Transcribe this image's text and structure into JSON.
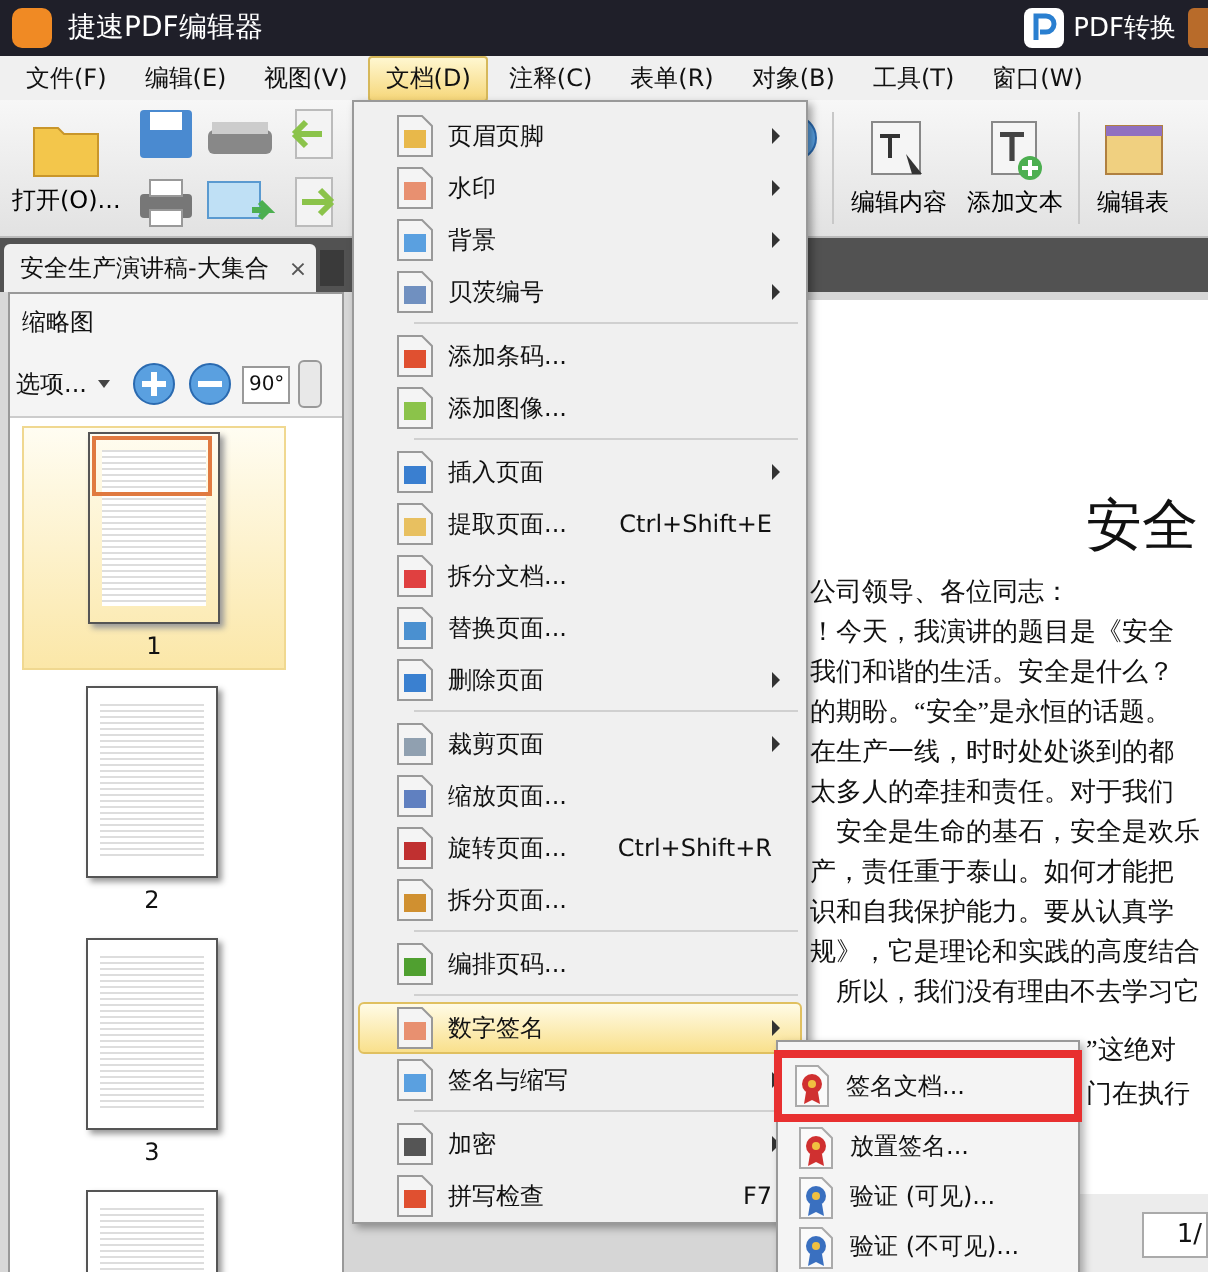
{
  "window": {
    "title": "捷速PDF编辑器",
    "convert_button": "PDF转换"
  },
  "menu_bar": [
    {
      "label": "文件(F)",
      "selected": false
    },
    {
      "label": "编辑(E)",
      "selected": false
    },
    {
      "label": "视图(V)",
      "selected": false
    },
    {
      "label": "文档(D)",
      "selected": true
    },
    {
      "label": "注释(C)",
      "selected": false
    },
    {
      "label": "表单(R)",
      "selected": false
    },
    {
      "label": "对象(B)",
      "selected": false
    },
    {
      "label": "工具(T)",
      "selected": false
    },
    {
      "label": "窗口(W)",
      "selected": false
    }
  ],
  "toolbar": {
    "open": "打开(O)...",
    "edit_content": "编辑内容",
    "add_text": "添加文本",
    "edit_form": "编辑表"
  },
  "document_tab": {
    "title": "安全生产演讲稿-大集合",
    "close": "×"
  },
  "thumbnail_panel": {
    "title": "缩略图",
    "options": "选项...",
    "rotate": "90°",
    "pages": [
      {
        "label": "1",
        "selected": true
      },
      {
        "label": "2",
        "selected": false
      },
      {
        "label": "3",
        "selected": false
      },
      {
        "selected": false
      }
    ]
  },
  "document": {
    "heading": "安全",
    "lines": [
      "公司领导、各位同志：",
      "！今天，我演讲的题目是《安全",
      "我们和谐的生活。安全是什么？",
      "的期盼。“安全”是永恒的话题。",
      "在生产一线，时时处处谈到的都",
      "太多人的牵挂和责任。对于我们",
      "　安全是生命的基石，安全是欢乐",
      "产，责任重于泰山。如何才能把",
      "识和自我保护能力。要从认真学",
      "规》，它是理论和实践的高度结合",
      "　所以，我们没有理由不去学习它"
    ],
    "covered_lines": [
      "”这绝对",
      "门在执行"
    ],
    "page_field": "1/"
  },
  "document_menu": [
    {
      "kind": "item",
      "label": "页眉页脚",
      "submenu": true,
      "selected": false
    },
    {
      "kind": "item",
      "label": "水印",
      "submenu": true,
      "selected": false
    },
    {
      "kind": "item",
      "label": "背景",
      "submenu": true,
      "selected": false
    },
    {
      "kind": "item",
      "label": "贝茨编号",
      "submenu": true,
      "selected": false
    },
    {
      "kind": "separator"
    },
    {
      "kind": "item",
      "label": "添加条码...",
      "submenu": false,
      "selected": false
    },
    {
      "kind": "item",
      "label": "添加图像...",
      "submenu": false,
      "selected": false
    },
    {
      "kind": "separator"
    },
    {
      "kind": "item",
      "label": "插入页面",
      "submenu": true,
      "selected": false
    },
    {
      "kind": "item",
      "label": "提取页面...",
      "shortcut": "Ctrl+Shift+E",
      "submenu": false,
      "selected": false
    },
    {
      "kind": "item",
      "label": "拆分文档...",
      "submenu": false,
      "selected": false
    },
    {
      "kind": "item",
      "label": "替换页面...",
      "submenu": false,
      "selected": false
    },
    {
      "kind": "item",
      "label": "删除页面",
      "submenu": true,
      "selected": false
    },
    {
      "kind": "separator"
    },
    {
      "kind": "item",
      "label": "裁剪页面",
      "submenu": true,
      "selected": false
    },
    {
      "kind": "item",
      "label": "缩放页面...",
      "submenu": false,
      "selected": false
    },
    {
      "kind": "item",
      "label": "旋转页面...",
      "shortcut": "Ctrl+Shift+R",
      "submenu": false,
      "selected": false
    },
    {
      "kind": "item",
      "label": "拆分页面...",
      "submenu": false,
      "selected": false
    },
    {
      "kind": "separator"
    },
    {
      "kind": "item",
      "label": "编排页码...",
      "submenu": false,
      "selected": false
    },
    {
      "kind": "separator"
    },
    {
      "kind": "item",
      "label": "数字签名",
      "submenu": true,
      "selected": true
    },
    {
      "kind": "item",
      "label": "签名与缩写",
      "submenu": true,
      "selected": false
    },
    {
      "kind": "separator"
    },
    {
      "kind": "item",
      "label": "加密",
      "submenu": true,
      "selected": false
    },
    {
      "kind": "item",
      "label": "拼写检查",
      "shortcut": "F7",
      "submenu": false,
      "selected": false
    }
  ],
  "signature_submenu": [
    {
      "label": "签名文档...",
      "highlighted": true
    },
    {
      "label": "放置签名...",
      "highlighted": false
    },
    {
      "label": "验证 (可见)...",
      "highlighted": false
    },
    {
      "label": "验证 (不可见)...",
      "highlighted": false
    }
  ]
}
